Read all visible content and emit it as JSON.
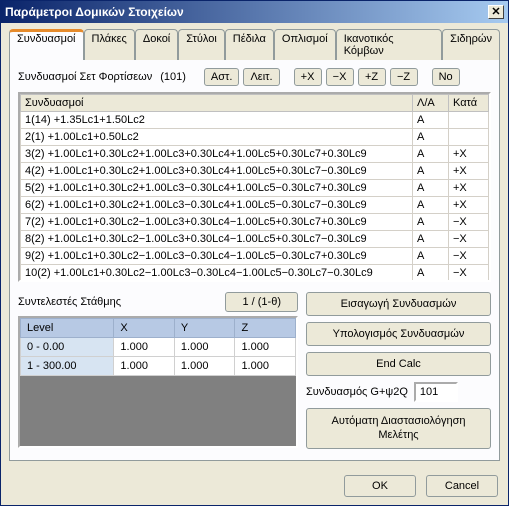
{
  "window": {
    "title": "Παράμετροι Δομικών Στοιχείων"
  },
  "tabs": [
    {
      "label": "Συνδυασμοί"
    },
    {
      "label": "Πλάκες"
    },
    {
      "label": "Δοκοί"
    },
    {
      "label": "Στύλοι"
    },
    {
      "label": "Πέδιλα"
    },
    {
      "label": "Οπλισμοί"
    },
    {
      "label": "Ικανοτικός Κόμβων"
    },
    {
      "label": "Σιδηρών"
    }
  ],
  "toolbar": {
    "label": "Συνδυασμοί Σετ Φορτίσεων",
    "count": "(101)",
    "ast": "Αστ.",
    "leit": "Λειτ.",
    "plusX": "+X",
    "minusX": "−X",
    "plusZ": "+Z",
    "minusZ": "−Z",
    "no": "No"
  },
  "gridHeaders": {
    "combo": "Συνδυασμοί",
    "la": "Λ/Α",
    "kata": "Κατά"
  },
  "gridRows": [
    {
      "combo": "1(14) +1.35Lc1+1.50Lc2",
      "la": "A",
      "kata": ""
    },
    {
      "combo": "2(1) +1.00Lc1+0.50Lc2",
      "la": "A",
      "kata": ""
    },
    {
      "combo": "3(2) +1.00Lc1+0.30Lc2+1.00Lc3+0.30Lc4+1.00Lc5+0.30Lc7+0.30Lc9",
      "la": "A",
      "kata": "+X"
    },
    {
      "combo": "4(2) +1.00Lc1+0.30Lc2+1.00Lc3+0.30Lc4+1.00Lc5+0.30Lc7−0.30Lc9",
      "la": "A",
      "kata": "+X"
    },
    {
      "combo": "5(2) +1.00Lc1+0.30Lc2+1.00Lc3−0.30Lc4+1.00Lc5−0.30Lc7+0.30Lc9",
      "la": "A",
      "kata": "+X"
    },
    {
      "combo": "6(2) +1.00Lc1+0.30Lc2+1.00Lc3−0.30Lc4+1.00Lc5−0.30Lc7−0.30Lc9",
      "la": "A",
      "kata": "+X"
    },
    {
      "combo": "7(2) +1.00Lc1+0.30Lc2−1.00Lc3+0.30Lc4−1.00Lc5+0.30Lc7+0.30Lc9",
      "la": "A",
      "kata": "−X"
    },
    {
      "combo": "8(2) +1.00Lc1+0.30Lc2−1.00Lc3+0.30Lc4−1.00Lc5+0.30Lc7−0.30Lc9",
      "la": "A",
      "kata": "−X"
    },
    {
      "combo": "9(2) +1.00Lc1+0.30Lc2−1.00Lc3−0.30Lc4−1.00Lc5−0.30Lc7+0.30Lc9",
      "la": "A",
      "kata": "−X"
    },
    {
      "combo": "10(2) +1.00Lc1+0.30Lc2−1.00Lc3−0.30Lc4−1.00Lc5−0.30Lc7−0.30Lc9",
      "la": "A",
      "kata": "−X"
    }
  ],
  "levels": {
    "label": "Συντελεστές Στάθμης",
    "formula": "1 / (1-θ)",
    "headers": {
      "level": "Level",
      "x": "X",
      "y": "Y",
      "z": "Z"
    },
    "rows": [
      {
        "level": "0 - 0.00",
        "x": "1.000",
        "y": "1.000",
        "z": "1.000"
      },
      {
        "level": "1 - 300.00",
        "x": "1.000",
        "y": "1.000",
        "z": "1.000"
      }
    ]
  },
  "right": {
    "import": "Εισαγωγή Συνδυασμών",
    "calc": "Υπολογισμός Συνδυασμών",
    "endcalc": "End Calc",
    "comboLabel": "Συνδυασμός G+ψ2Q",
    "comboValue": "101",
    "dim": "Αυτόματη Διαστασιολόγηση Μελέτης"
  },
  "footer": {
    "ok": "OK",
    "cancel": "Cancel"
  }
}
